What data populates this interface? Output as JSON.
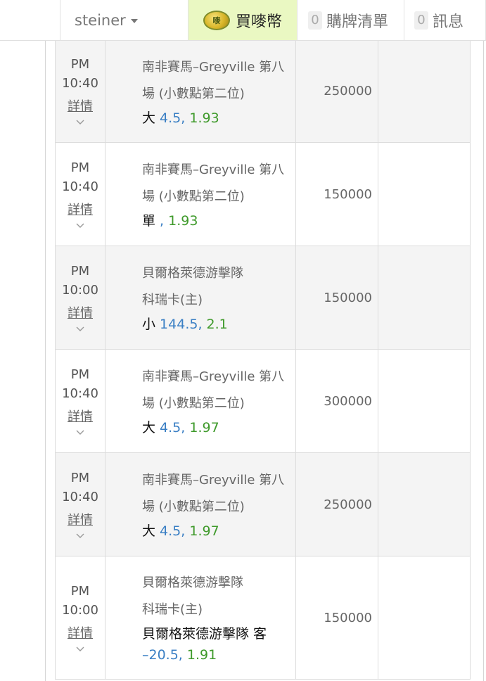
{
  "header": {
    "username": "steiner",
    "buy_coin": {
      "label": "買嘜幣",
      "icon": "coin-icon",
      "icon_text": "嘜",
      "bg_color": "#eaf8c2"
    },
    "cart": {
      "count": "0",
      "label": "購牌清單"
    },
    "messages": {
      "count": "0",
      "label": "訊息"
    }
  },
  "colors": {
    "handicap": "#3a7fc4",
    "odds": "#3f9a2b",
    "row_shade": "#f4f4f4"
  },
  "rows": [
    {
      "ampm": "PM",
      "time": "10:40",
      "detail": "詳情",
      "event_line1": "南非賽馬–Greyville 第八",
      "event_line2": "場 (小數點第二位)",
      "sel": "大",
      "hcap": " 4.5,",
      "odds": " 1.93",
      "amount": "250000"
    },
    {
      "ampm": "PM",
      "time": "10:40",
      "detail": "詳情",
      "event_line1": "南非賽馬–Greyville 第八",
      "event_line2": "場 (小數點第二位)",
      "sel": "單",
      "hcap": " ,",
      "odds": " 1.93",
      "amount": "150000"
    },
    {
      "ampm": "PM",
      "time": "10:00",
      "detail": "詳情",
      "event_line1": "貝爾格萊德游擊隊",
      "event_line2": "科瑞卡(主)",
      "sel": "小",
      "hcap": " 144.5,",
      "odds": " 2.1",
      "amount": "150000"
    },
    {
      "ampm": "PM",
      "time": "10:40",
      "detail": "詳情",
      "event_line1": "南非賽馬–Greyville 第八",
      "event_line2": "場 (小數點第二位)",
      "sel": "大",
      "hcap": " 4.5,",
      "odds": " 1.97",
      "amount": "300000"
    },
    {
      "ampm": "PM",
      "time": "10:40",
      "detail": "詳情",
      "event_line1": "南非賽馬–Greyville 第八",
      "event_line2": "場 (小數點第二位)",
      "sel": "大",
      "hcap": " 4.5,",
      "odds": " 1.97",
      "amount": "250000"
    },
    {
      "ampm": "PM",
      "time": "10:00",
      "detail": "詳情",
      "event_line1": "貝爾格萊德游擊隊",
      "event_line2": "科瑞卡(主)",
      "sel": "貝爾格萊德游擊隊 客",
      "hcap": "–20.5,",
      "odds": " 1.91",
      "amount": "150000"
    }
  ]
}
